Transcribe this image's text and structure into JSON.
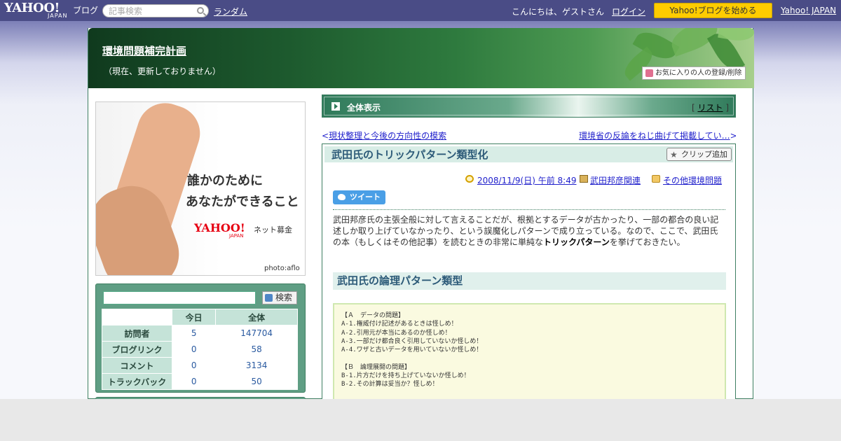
{
  "topbar": {
    "logo_yahoo": "YAHOO!",
    "logo_japan": "JAPAN",
    "logo_blog": "ブログ",
    "search_placeholder": "記事検索",
    "random_link": "ランダム",
    "greeting": "こんにちは、ゲストさん",
    "login_link": "ログイン",
    "start_blog_button": "Yahoo!ブログを始める",
    "yahoo_japan_link": "Yahoo! JAPAN"
  },
  "header": {
    "blog_title": "環境問題補完計画",
    "subtitle": "（現在、更新しておりません）",
    "favorite_button": "お気に入りの人の登録/削除"
  },
  "ad": {
    "line1": "誰かのために",
    "line2": "あなたができること",
    "logo_yahoo": "YAHOO!",
    "logo_japan": "JAPAN",
    "net_donation": "ネット募金",
    "photo_credit": "photo:aflo"
  },
  "sidebar": {
    "search_value": "",
    "search_button": "検索",
    "stats": {
      "headers": [
        "今日",
        "全体"
      ],
      "rows": [
        {
          "label": "訪問者",
          "today": "5",
          "total": "147704"
        },
        {
          "label": "ブログリンク",
          "today": "0",
          "total": "58"
        },
        {
          "label": "コメント",
          "today": "0",
          "total": "3134"
        },
        {
          "label": "トラックバック",
          "today": "0",
          "total": "50"
        }
      ]
    }
  },
  "section": {
    "label": "全体表示",
    "list_open": "[",
    "list_link": "リスト",
    "list_close": "]"
  },
  "nav": {
    "prev_arrow": "<",
    "prev_title": "現状整理と今後の方向性の模索",
    "next_title": "環境省の反論をねじ曲げて掲載してい…",
    "next_arrow": ">"
  },
  "article": {
    "title": "武田氏のトリックパターン類型化",
    "clip_button": "クリップ追加",
    "date": "2008/11/9(日) 午前 8:49",
    "category1": "武田邦彦関連",
    "category2": "その他環境問題",
    "tweet_button": "ツイート",
    "body_part1": "武田邦彦氏の主張全般に対して言えることだが、根拠とするデータが古かったり、一部の都合の良い記述しか取り上げていなかったり、という誤魔化しパターンで成り立っている。なので、ここで、武田氏の本（もしくはその他記事）を読むときの非常に単純な",
    "body_bold": "トリックパターン",
    "body_part2": "を挙げておきたい。",
    "heading": "武田氏の論理パターン類型",
    "code_lines": [
      "【Ａ　データの問題】",
      "A-1.権威付け記述があるときは怪しめ！",
      "A-2.引用元が本当にあるのか怪しめ！",
      "A-3.一部だけ都合良く引用していないか怪しめ！",
      "A-4.ワザと古いデータを用いていないか怪しめ！",
      "",
      "【Ｂ　論理展開の問題】",
      "B-1.片方だけを持ち上げていないか怪しめ！",
      "B-2.その計算は妥当か？怪しめ！"
    ]
  },
  "colors": {
    "topbar": "#4a4c86",
    "accent_green": "#3f7f62",
    "start_button": "#ffcc00",
    "link": "#2222cc"
  }
}
